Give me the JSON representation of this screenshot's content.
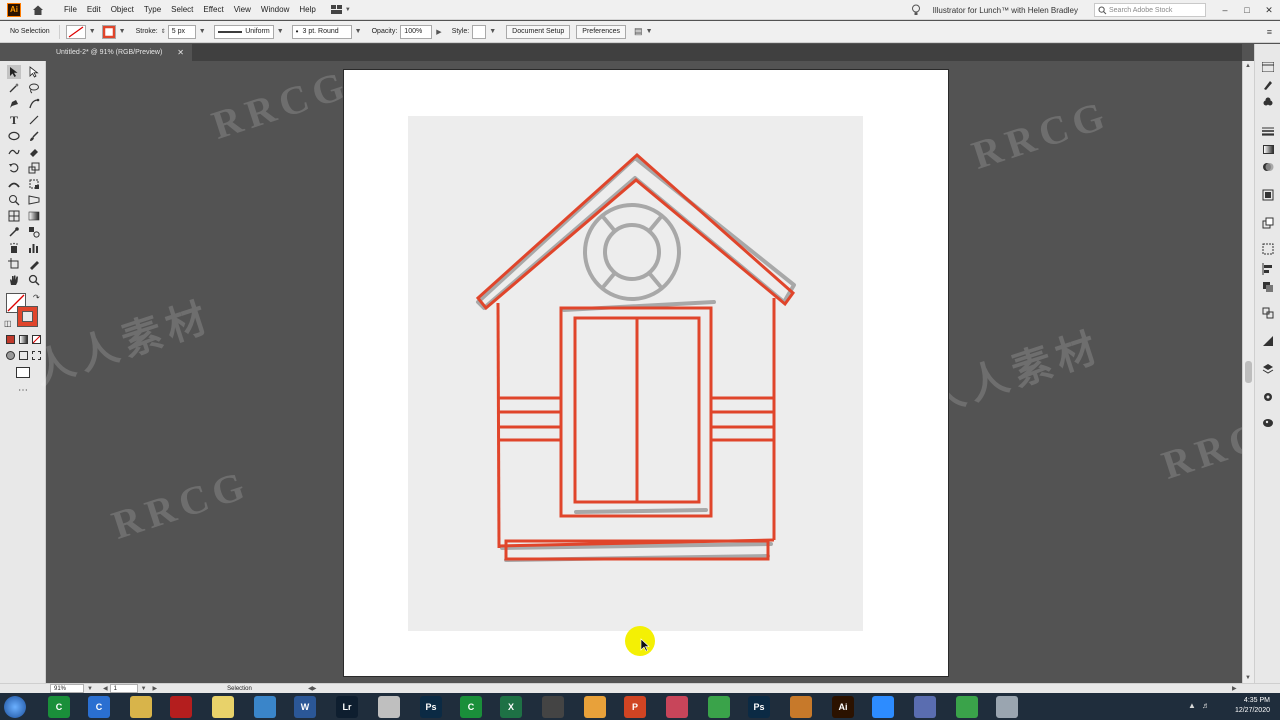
{
  "app": {
    "logo": "Ai",
    "menus": [
      "File",
      "Edit",
      "Object",
      "Type",
      "Select",
      "Effect",
      "View",
      "Window",
      "Help"
    ],
    "workspace_title": "Illustrator for Lunch™ with Helen Bradley",
    "search_placeholder": "Search Adobe Stock",
    "window_controls": [
      "–",
      "□",
      "✕"
    ]
  },
  "control_bar": {
    "selection": "No Selection",
    "stroke_label": "Stroke:",
    "stroke_value": "5 px",
    "profile": "Uniform",
    "brush": "3 pt. Round",
    "opacity_label": "Opacity:",
    "opacity_value": "100%",
    "style_label": "Style:",
    "doc_setup": "Document Setup",
    "preferences": "Preferences"
  },
  "document": {
    "tab_title": "Untitled-2* @ 91% (RGB/Preview)",
    "close": "✕"
  },
  "status_bar": {
    "zoom": "91%",
    "artboard": "1",
    "tool": "Selection"
  },
  "taskbar": {
    "time": "4:35 PM",
    "date": "12/27/2020",
    "apps": [
      {
        "name": "C",
        "color": "#1a8f3a"
      },
      {
        "name": "C",
        "color": "#2a6fd1"
      },
      {
        "name": "",
        "color": "#d8b44a"
      },
      {
        "name": "",
        "color": "#b41e1e"
      },
      {
        "name": "",
        "color": "#e8d26a"
      },
      {
        "name": "",
        "color": "#3a85c9"
      },
      {
        "name": "W",
        "color": "#2b5797"
      },
      {
        "name": "Lr",
        "color": "#0e1e2f"
      },
      {
        "name": "",
        "color": "#bfbfbf"
      },
      {
        "name": "Ps",
        "color": "#0b2a44"
      },
      {
        "name": "C",
        "color": "#1a8f3a"
      },
      {
        "name": "X",
        "color": "#1e7145"
      },
      {
        "name": "",
        "color": "#444"
      },
      {
        "name": "",
        "color": "#e8a13a"
      },
      {
        "name": "P",
        "color": "#d04423"
      },
      {
        "name": "",
        "color": "#c8455a"
      },
      {
        "name": "",
        "color": "#3aa34a"
      },
      {
        "name": "Ps",
        "color": "#0b2a44"
      },
      {
        "name": "",
        "color": "#c7792a"
      },
      {
        "name": "Ai",
        "color": "#2b1200"
      },
      {
        "name": "",
        "color": "#2d8cff"
      },
      {
        "name": "",
        "color": "#5a6db0"
      },
      {
        "name": "",
        "color": "#3aa34a"
      },
      {
        "name": "",
        "color": "#9aa5b0"
      }
    ]
  },
  "colors": {
    "accent_stroke": "#e0452b",
    "sketch_stroke": "#a8a8a8"
  },
  "watermarks": [
    "RRCG",
    "人人素材"
  ]
}
